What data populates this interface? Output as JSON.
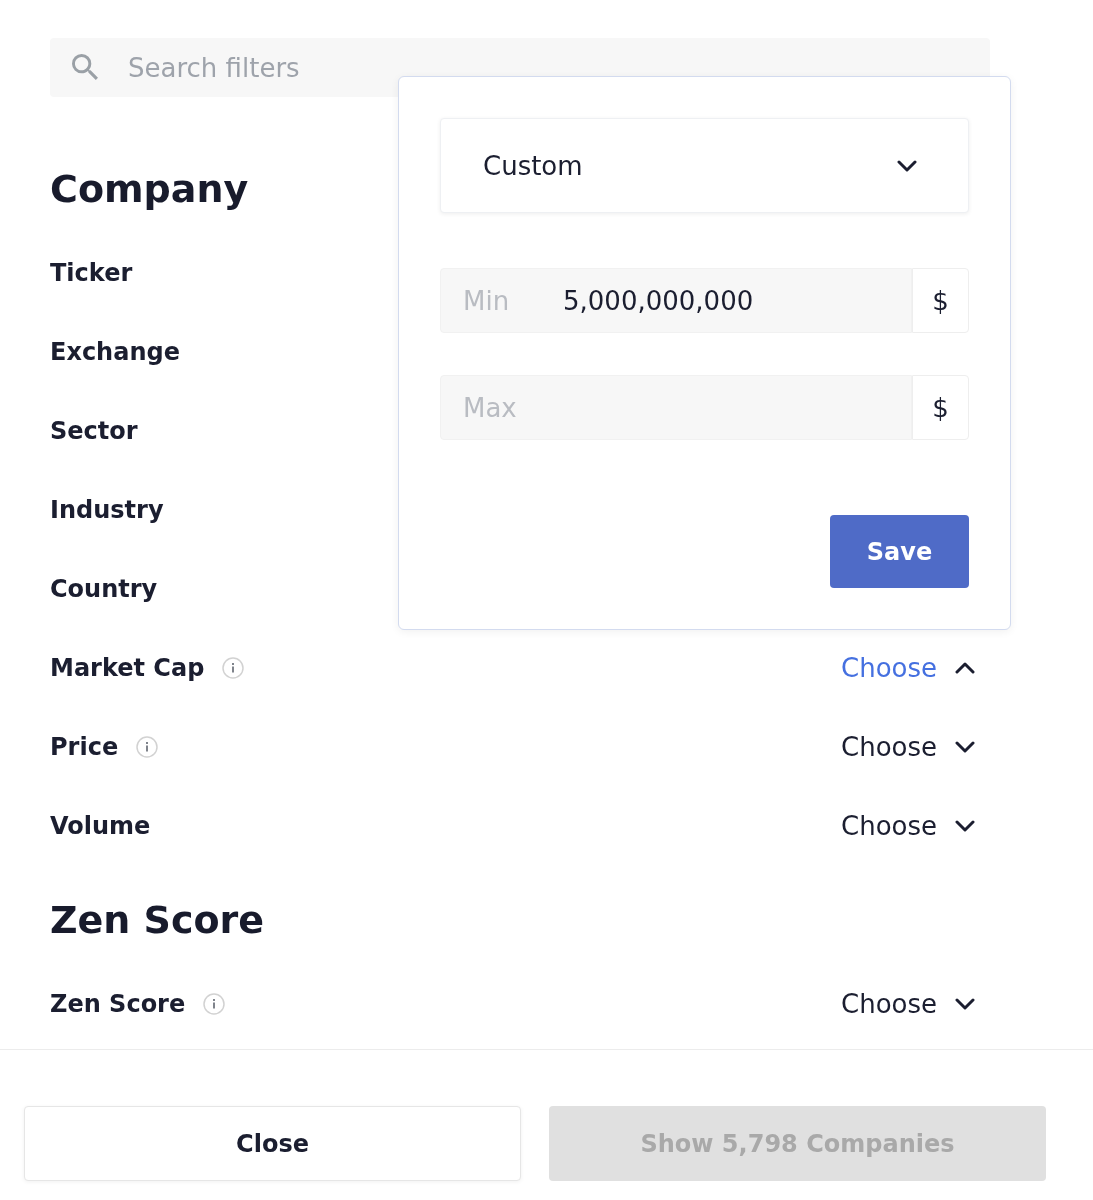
{
  "search": {
    "placeholder": "Search filters"
  },
  "sections": [
    {
      "title": "Company",
      "filters": [
        {
          "label": "Ticker",
          "info": false
        },
        {
          "label": "Exchange",
          "info": false
        },
        {
          "label": "Sector",
          "info": false
        },
        {
          "label": "Industry",
          "info": false
        },
        {
          "label": "Country",
          "info": false
        },
        {
          "label": "Market Cap",
          "info": true,
          "choose": {
            "label": "Choose",
            "expanded": true
          }
        },
        {
          "label": "Price",
          "info": true,
          "choose": {
            "label": "Choose",
            "expanded": false
          }
        },
        {
          "label": "Volume",
          "info": false,
          "choose": {
            "label": "Choose",
            "expanded": false
          }
        }
      ]
    },
    {
      "title": "Zen Score",
      "filters": [
        {
          "label": "Zen Score",
          "info": true,
          "choose": {
            "label": "Choose",
            "expanded": false
          }
        }
      ]
    }
  ],
  "popover": {
    "preset": {
      "value": "Custom",
      "expanded": false
    },
    "fields": [
      {
        "label": "Min",
        "value": "5,000,000,000",
        "unit": "$"
      },
      {
        "label": "Max",
        "unit": "$"
      }
    ],
    "save": "Save"
  },
  "footer": {
    "buttons": [
      {
        "label": "Close",
        "kind": "secondary",
        "disabled": false
      },
      {
        "label": "Show 5,798 Companies",
        "kind": "primary",
        "disabled": true
      }
    ]
  }
}
